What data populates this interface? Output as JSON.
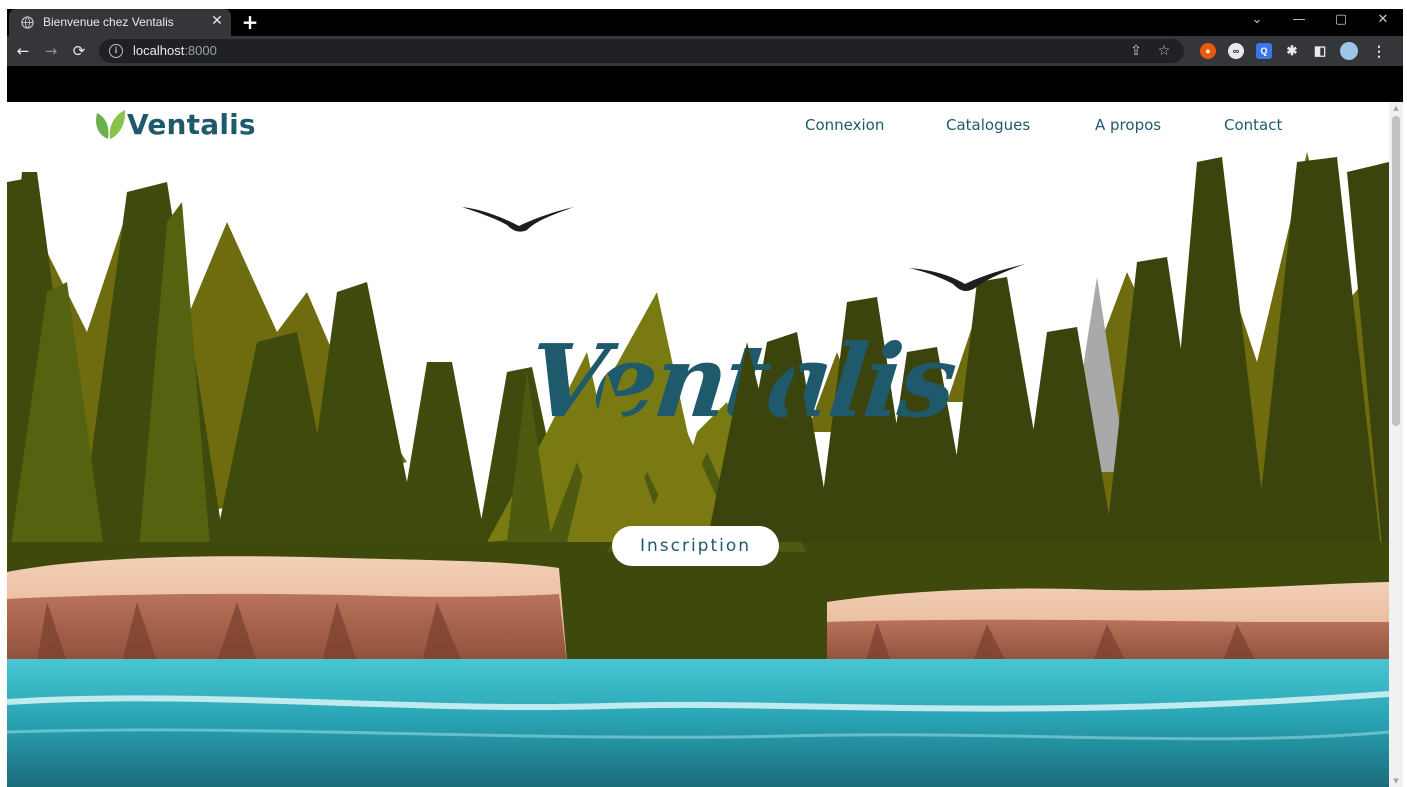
{
  "browser": {
    "tab": {
      "title": "Bienvenue chez Ventalis",
      "icon": "globe-icon"
    },
    "new_tab_label": "+",
    "address": {
      "host": "localhost",
      "port": ":8000"
    },
    "window_controls": [
      "chevron-down",
      "minimize",
      "restore",
      "close"
    ],
    "extensions": [
      "share-icon",
      "star-icon",
      "extension-orange",
      "extension-dark",
      "extension-q",
      "puzzle-icon",
      "sidepanel-icon",
      "profile-avatar",
      "kebab-menu-icon"
    ]
  },
  "site": {
    "brand": "Ventalis",
    "nav": [
      {
        "label": "Connexion"
      },
      {
        "label": "Catalogues"
      },
      {
        "label": "A propos"
      },
      {
        "label": "Contact"
      }
    ],
    "hero": {
      "title": "Ventalis",
      "cta_label": "Inscription"
    }
  },
  "colors": {
    "brand_teal": "#1e5a6c",
    "leaf_green": "#6ab04c",
    "forest_olive": "#6b6a12",
    "forest_dark": "#3e4a0c",
    "cliff": "#e7b79a",
    "water": "#2fb7c6"
  }
}
